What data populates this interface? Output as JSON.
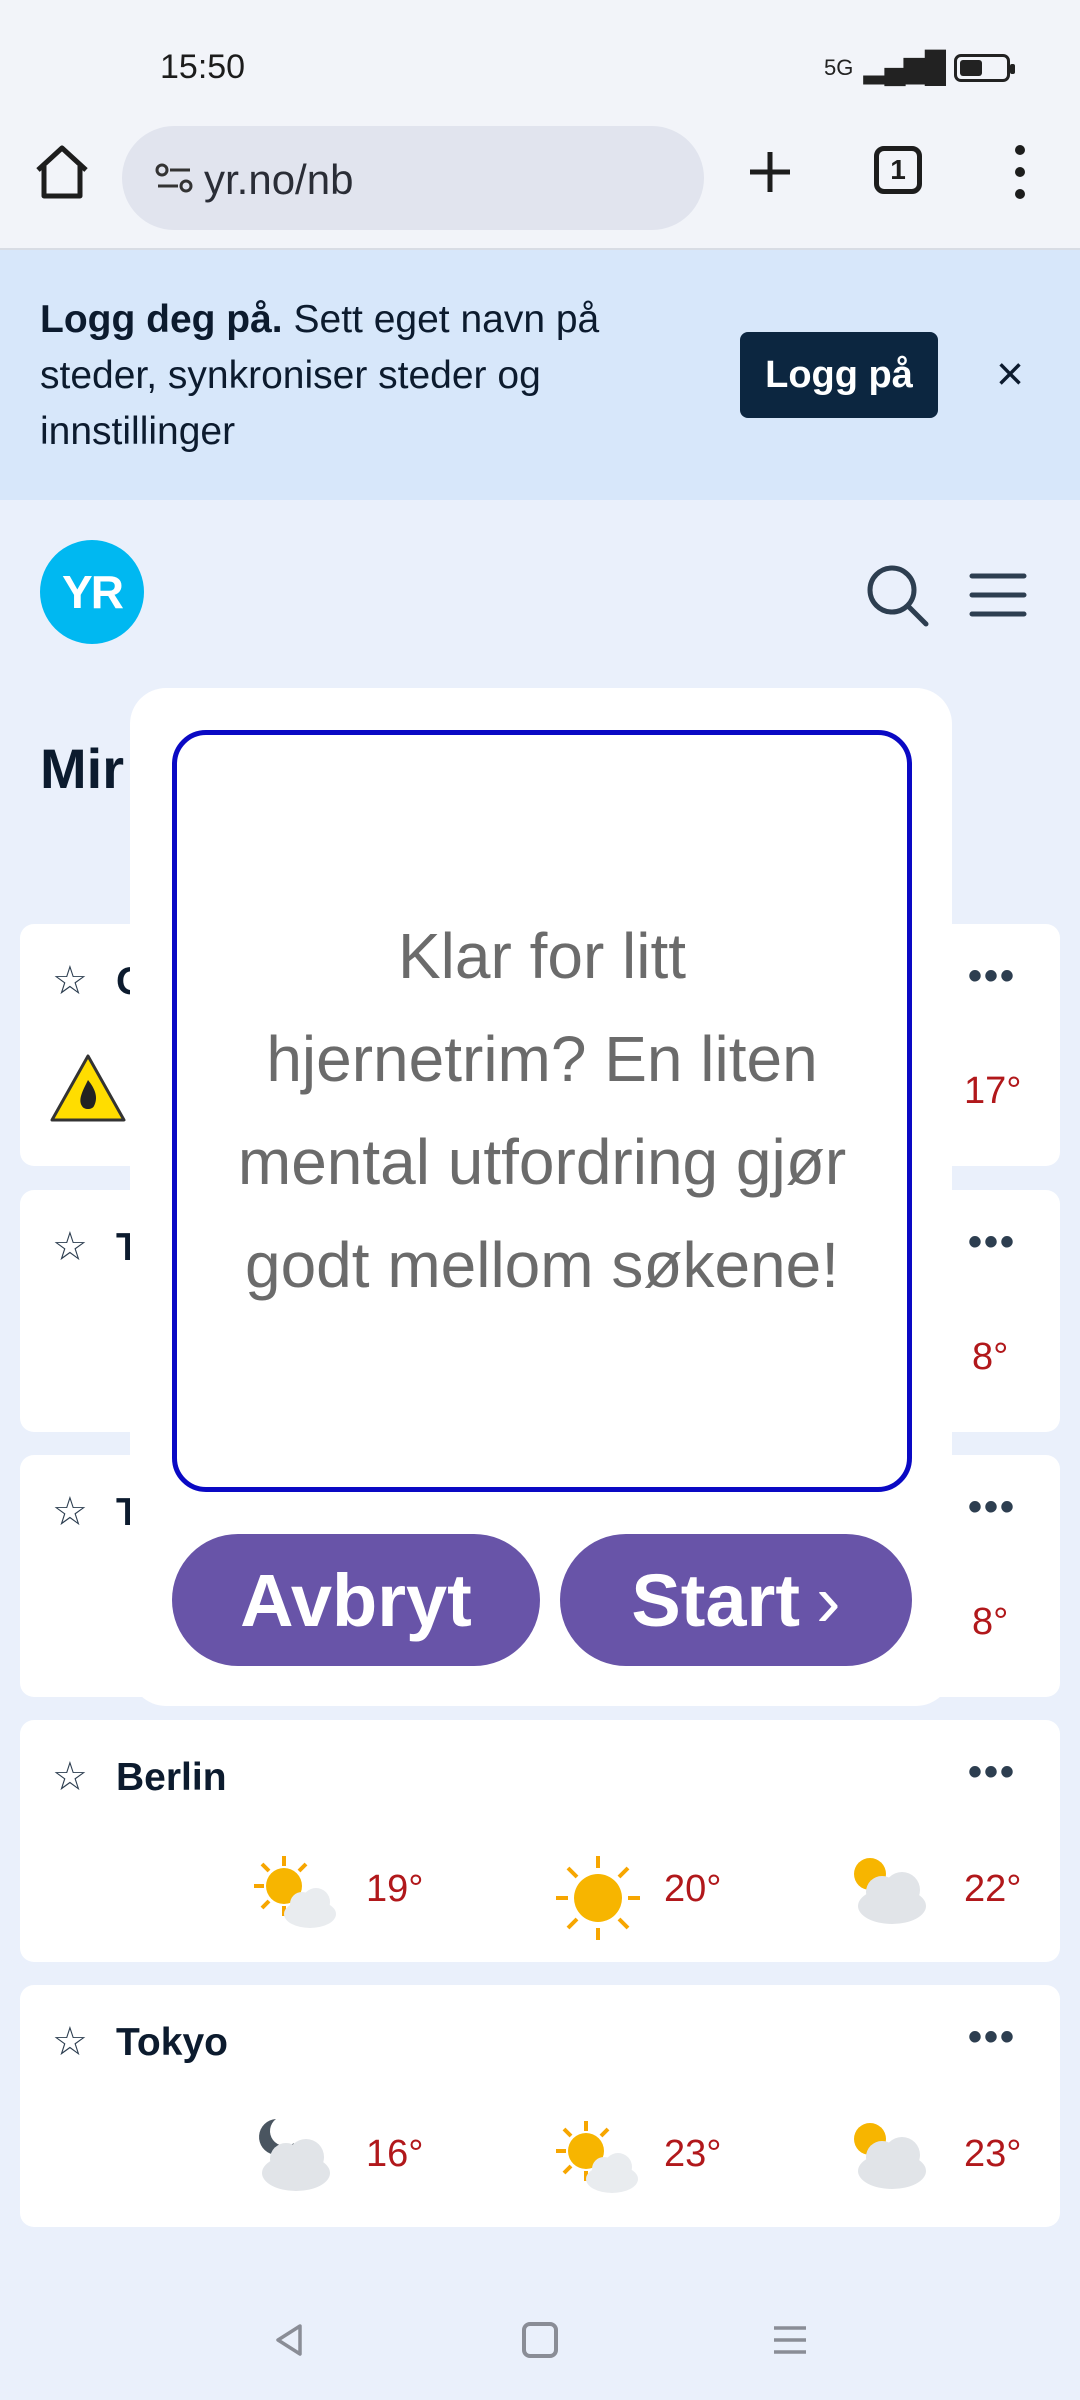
{
  "status_bar": {
    "time": "15:50",
    "network": "5G"
  },
  "browser": {
    "url": "yr.no/nb",
    "tab_count": "1"
  },
  "login_banner": {
    "bold_text": "Logg deg på.",
    "text": "Sett eget navn på steder, synkroniser steder og innstillinger",
    "button_label": "Logg på",
    "close_label": "×"
  },
  "header": {
    "logo_text": "YR",
    "page_title": "Mir"
  },
  "locations": [
    {
      "name": "O",
      "temps": [
        "17°"
      ]
    },
    {
      "name": "T",
      "temps": [
        "8°"
      ]
    },
    {
      "name": "T",
      "temps": [
        "8°"
      ]
    },
    {
      "name": "Berlin",
      "temps": [
        "19°",
        "20°",
        "22°"
      ]
    },
    {
      "name": "Tokyo",
      "temps": [
        "16°",
        "23°",
        "23°"
      ]
    }
  ],
  "modal": {
    "message": "Klar for litt hjernetrim? En liten mental utfordring gjør godt mellom søkene!",
    "cancel_label": "Avbryt",
    "start_label": "Start"
  },
  "colors": {
    "accent_purple": "#6854a8",
    "modal_border": "#0a09c4",
    "temperature": "#b1181b",
    "logo_blue": "#00b8f1"
  },
  "icons": {
    "card_star": "☆",
    "card_more": "•••",
    "start_chevron": "›"
  }
}
